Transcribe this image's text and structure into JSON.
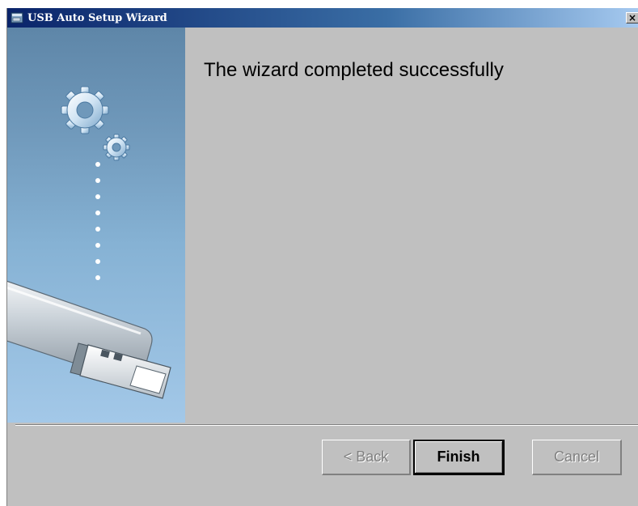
{
  "window": {
    "title": "USB Auto Setup Wizard",
    "close_label": "×",
    "close_icon": "close-icon",
    "app_icon": "usb-wizard-app-icon"
  },
  "side_panel": {
    "graphic": "usb-drive-with-gears-illustration",
    "icons": [
      "gear-icon",
      "usb-drive-icon"
    ]
  },
  "main": {
    "headline": "The wizard completed successfully"
  },
  "buttons": {
    "back": {
      "label": "< Back",
      "enabled": false
    },
    "finish": {
      "label": "Finish",
      "enabled": true,
      "default": true
    },
    "cancel": {
      "label": "Cancel",
      "enabled": false
    }
  },
  "colors": {
    "titlebar_start": "#0a246a",
    "titlebar_end": "#a6caf0",
    "dialog_face": "#c0c0c0",
    "side_panel_top": "#5e86a8",
    "side_panel_bottom": "#a3c8e8",
    "disabled_text": "#808080"
  }
}
